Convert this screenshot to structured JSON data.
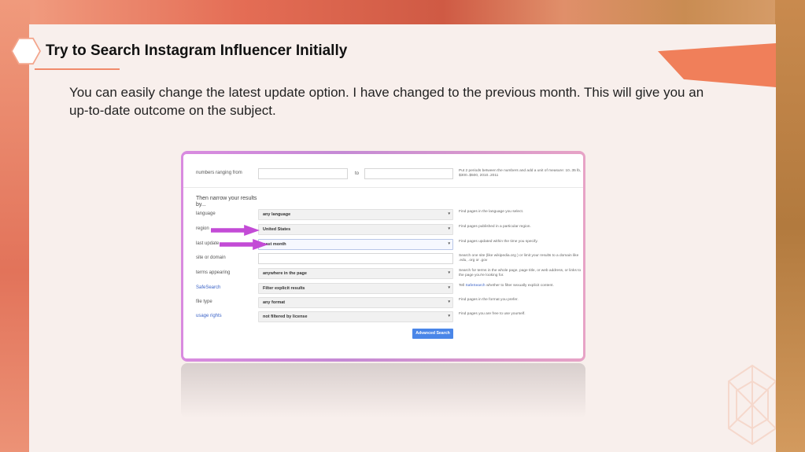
{
  "slide": {
    "title": "Try to Search Instagram Influencer Initially",
    "body": "You can easily change the latest update option. I have changed to the previous month. This will give you an up-to-date outcome on the subject."
  },
  "screenshot": {
    "numbers_range": {
      "label": "numbers ranging from",
      "to_label": "to",
      "help": "Put 2 periods between the numbers and add a unit of measure: 10..35 lb, $300..$500, 2010..2011"
    },
    "narrow_heading": "Then narrow your results by...",
    "rows": [
      {
        "label": "language",
        "value": "any language",
        "help": "Find pages in the language you select."
      },
      {
        "label": "region",
        "value": "United States",
        "help": "Find pages published in a particular region."
      },
      {
        "label": "last update",
        "value": "past month",
        "help": "Find pages updated within the time you specify."
      },
      {
        "label": "site or domain",
        "value": "",
        "help": "Search one site (like  wikipedia.org ) or limit your results to a domain like .edu, .org or .gov"
      },
      {
        "label": "terms appearing",
        "value": "anywhere in the page",
        "help": "Search for terms in the whole page, page title, or web address, or links to the page you're looking for."
      },
      {
        "label": "SafeSearch",
        "value": "Filter explicit results",
        "help_link": "SafeSearch",
        "help": "Tell SafeSearch whether to filter sexually explicit content."
      },
      {
        "label": "file type",
        "value": "any format",
        "help": "Find pages in the format you prefer."
      },
      {
        "label": "usage rights",
        "value": "not filtered by license",
        "help": "Find pages you are free to use yourself."
      }
    ],
    "advanced_button": "Advanced Search"
  },
  "colors": {
    "accent": "#f08a6b",
    "arrow": "#c34bd6",
    "button": "#4a86e8",
    "link": "#3b63c7"
  }
}
